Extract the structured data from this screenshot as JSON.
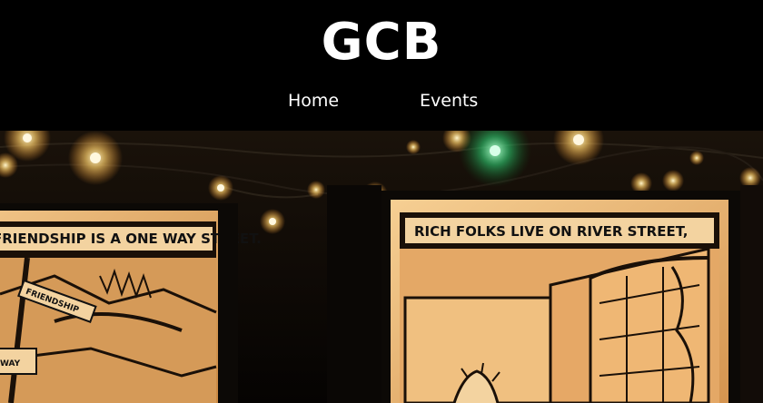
{
  "site": {
    "title": "GCB"
  },
  "nav": {
    "items": [
      {
        "label": "Home"
      },
      {
        "label": "Events"
      }
    ]
  },
  "hero": {
    "panel_left_caption": "FRIENDSHIP IS A ONE WAY STREET.",
    "panel_right_caption": "RICH FOLKS LIVE ON RIVER STREET,",
    "sign_friendship": "FRIENDSHIP",
    "sign_way": "WAY"
  },
  "colors": {
    "header_bg": "#000000",
    "text": "#ffffff",
    "light": "#ffd98a",
    "panel": "#e8b070"
  }
}
